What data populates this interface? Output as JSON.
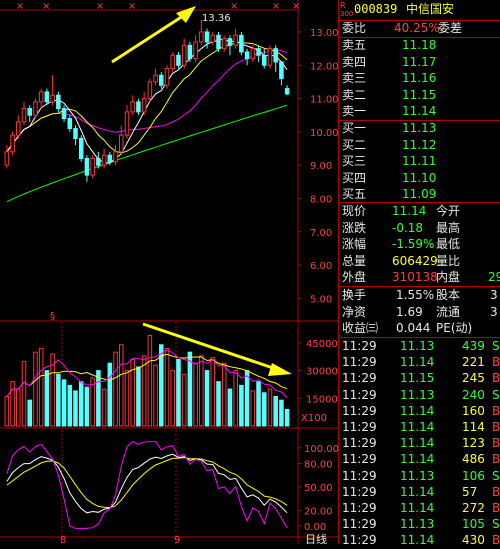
{
  "colors": {
    "bg": "#000000",
    "up": "#ff3232",
    "down": "#54ffff",
    "ma5": "#ffffff",
    "ma10": "#ffff00",
    "ma20": "#ff00ff",
    "ma60": "#00ff00",
    "axis": "#b00000",
    "label_red": "#ff4040",
    "label_green": "#33ff33",
    "label_yellow": "#ffff33",
    "arrow": "#ffff00"
  },
  "header": {
    "code": "000839",
    "name": "中信国安",
    "badge_top": "R",
    "badge_bottom": "300"
  },
  "weibi": {
    "label": "委比",
    "value": "40.25%",
    "label2": "委差"
  },
  "asks": [
    {
      "label": "卖五",
      "price": "11.18"
    },
    {
      "label": "卖四",
      "price": "11.17"
    },
    {
      "label": "卖三",
      "price": "11.16"
    },
    {
      "label": "卖二",
      "price": "11.15"
    },
    {
      "label": "卖一",
      "price": "11.14"
    }
  ],
  "bids": [
    {
      "label": "买一",
      "price": "11.13"
    },
    {
      "label": "买二",
      "price": "11.12"
    },
    {
      "label": "买三",
      "price": "11.11"
    },
    {
      "label": "买四",
      "price": "11.10"
    },
    {
      "label": "买五",
      "price": "11.09"
    }
  ],
  "quote": [
    {
      "label": "现价",
      "value": "11.14",
      "label2": "今开"
    },
    {
      "label": "涨跌",
      "value": "-0.18",
      "label2": "最高"
    },
    {
      "label": "涨幅",
      "value": "-1.59%",
      "label2": "最低"
    },
    {
      "label": "总量",
      "value": "606429",
      "label2": "量比"
    },
    {
      "label": "外盘",
      "value": "310138",
      "label2": "内盘",
      "tail": "29"
    }
  ],
  "stats": [
    {
      "label": "换手",
      "value": "1.55%",
      "label2": "股本",
      "tail": "3"
    },
    {
      "label": "净资",
      "value": "1.69",
      "label2": "流通",
      "tail": "3"
    },
    {
      "label": "收益㈢",
      "value": "0.044",
      "label2": "PE(动)",
      "tail": ""
    }
  ],
  "ticks": [
    {
      "time": "11:29",
      "price": "11.13",
      "vol": "439",
      "flag": "S"
    },
    {
      "time": "11:29",
      "price": "11.14",
      "vol": "221",
      "flag": "B"
    },
    {
      "time": "11:29",
      "price": "11.15",
      "vol": "245",
      "flag": "B"
    },
    {
      "time": "11:29",
      "price": "11.13",
      "vol": "240",
      "flag": "S"
    },
    {
      "time": "11:29",
      "price": "11.14",
      "vol": "160",
      "flag": "B"
    },
    {
      "time": "11:29",
      "price": "11.14",
      "vol": "114",
      "flag": "B"
    },
    {
      "time": "11:29",
      "price": "11.14",
      "vol": "123",
      "flag": "B"
    },
    {
      "time": "11:29",
      "price": "11.14",
      "vol": "486",
      "flag": "B"
    },
    {
      "time": "11:29",
      "price": "11.13",
      "vol": "106",
      "flag": "S"
    },
    {
      "time": "11:29",
      "price": "11.14",
      "vol": "57",
      "flag": "B"
    },
    {
      "time": "11:29",
      "price": "11.14",
      "vol": "272",
      "flag": "B"
    },
    {
      "time": "11:29",
      "price": "11.13",
      "vol": "105",
      "flag": "S"
    },
    {
      "time": "11:29",
      "price": "11.14",
      "vol": "430",
      "flag": "B"
    }
  ],
  "price_chart": {
    "y_ticks": [
      "13.00",
      "12.00",
      "11.00",
      "10.00",
      "9.00",
      "8.00",
      "7.00",
      "6.00",
      "5.00"
    ],
    "high_label": "13.36",
    "top_markers": [
      "×",
      "×",
      "×",
      "×",
      "×",
      "×",
      "×"
    ],
    "month_marker": "§",
    "candles": [
      {
        "o": 9.0,
        "c": 9.4,
        "h": 9.6,
        "l": 8.9
      },
      {
        "o": 9.4,
        "c": 9.9,
        "h": 10.0,
        "l": 9.3
      },
      {
        "o": 9.9,
        "c": 10.3,
        "h": 10.5,
        "l": 9.8
      },
      {
        "o": 10.3,
        "c": 10.7,
        "h": 10.9,
        "l": 10.2
      },
      {
        "o": 10.7,
        "c": 10.5,
        "h": 10.8,
        "l": 10.3
      },
      {
        "o": 10.5,
        "c": 10.9,
        "h": 11.0,
        "l": 10.4
      },
      {
        "o": 10.9,
        "c": 11.2,
        "h": 11.3,
        "l": 10.7
      },
      {
        "o": 11.2,
        "c": 10.9,
        "h": 11.3,
        "l": 10.8
      },
      {
        "o": 10.9,
        "c": 11.1,
        "h": 11.7,
        "l": 10.8
      },
      {
        "o": 11.1,
        "c": 10.7,
        "h": 11.2,
        "l": 10.6
      },
      {
        "o": 10.7,
        "c": 10.4,
        "h": 10.8,
        "l": 10.3
      },
      {
        "o": 10.4,
        "c": 10.1,
        "h": 10.5,
        "l": 10.0
      },
      {
        "o": 10.1,
        "c": 9.8,
        "h": 10.2,
        "l": 9.6
      },
      {
        "o": 9.8,
        "c": 9.2,
        "h": 9.9,
        "l": 9.1
      },
      {
        "o": 9.2,
        "c": 8.7,
        "h": 9.3,
        "l": 8.5
      },
      {
        "o": 8.7,
        "c": 9.2,
        "h": 9.3,
        "l": 8.6
      },
      {
        "o": 9.2,
        "c": 9.0,
        "h": 9.4,
        "l": 8.9
      },
      {
        "o": 9.0,
        "c": 9.3,
        "h": 9.5,
        "l": 8.9
      },
      {
        "o": 9.3,
        "c": 9.1,
        "h": 9.4,
        "l": 9.0
      },
      {
        "o": 9.1,
        "c": 9.4,
        "h": 9.6,
        "l": 9.0
      },
      {
        "o": 9.4,
        "c": 9.9,
        "h": 10.2,
        "l": 9.3
      },
      {
        "o": 9.9,
        "c": 10.6,
        "h": 10.8,
        "l": 9.8
      },
      {
        "o": 10.6,
        "c": 10.9,
        "h": 11.1,
        "l": 10.5
      },
      {
        "o": 10.9,
        "c": 10.6,
        "h": 11.0,
        "l": 10.5
      },
      {
        "o": 10.6,
        "c": 11.0,
        "h": 11.2,
        "l": 10.5
      },
      {
        "o": 11.0,
        "c": 11.5,
        "h": 11.6,
        "l": 10.9
      },
      {
        "o": 11.5,
        "c": 11.7,
        "h": 11.9,
        "l": 11.4
      },
      {
        "o": 11.7,
        "c": 11.4,
        "h": 11.8,
        "l": 11.3
      },
      {
        "o": 11.4,
        "c": 11.9,
        "h": 12.0,
        "l": 11.3
      },
      {
        "o": 11.9,
        "c": 12.3,
        "h": 12.4,
        "l": 11.8
      },
      {
        "o": 12.3,
        "c": 12.0,
        "h": 12.4,
        "l": 11.9
      },
      {
        "o": 12.0,
        "c": 12.6,
        "h": 12.8,
        "l": 11.9
      },
      {
        "o": 12.6,
        "c": 12.2,
        "h": 12.7,
        "l": 12.1
      },
      {
        "o": 12.2,
        "c": 12.7,
        "h": 12.9,
        "l": 12.1
      },
      {
        "o": 12.7,
        "c": 13.0,
        "h": 13.36,
        "l": 12.6
      },
      {
        "o": 13.0,
        "c": 12.7,
        "h": 13.1,
        "l": 12.5
      },
      {
        "o": 12.7,
        "c": 12.9,
        "h": 13.0,
        "l": 12.6
      },
      {
        "o": 12.9,
        "c": 12.5,
        "h": 13.0,
        "l": 12.4
      },
      {
        "o": 12.5,
        "c": 12.8,
        "h": 12.9,
        "l": 12.4
      },
      {
        "o": 12.8,
        "c": 12.6,
        "h": 12.9,
        "l": 12.3
      },
      {
        "o": 12.6,
        "c": 12.9,
        "h": 13.1,
        "l": 12.5
      },
      {
        "o": 12.9,
        "c": 12.4,
        "h": 13.0,
        "l": 12.3
      },
      {
        "o": 12.4,
        "c": 12.2,
        "h": 12.5,
        "l": 12.0
      },
      {
        "o": 12.2,
        "c": 12.5,
        "h": 12.6,
        "l": 12.1
      },
      {
        "o": 12.5,
        "c": 12.3,
        "h": 12.6,
        "l": 12.1
      },
      {
        "o": 12.3,
        "c": 12.0,
        "h": 12.5,
        "l": 11.9
      },
      {
        "o": 12.0,
        "c": 12.5,
        "h": 12.6,
        "l": 11.9
      },
      {
        "o": 12.5,
        "c": 12.1,
        "h": 12.6,
        "l": 11.8
      },
      {
        "o": 12.1,
        "c": 11.6,
        "h": 12.0,
        "l": 11.4
      },
      {
        "o": 11.3,
        "c": 11.14,
        "h": 11.4,
        "l": 11.1
      }
    ],
    "ma60_start": 7.9,
    "ma60_end": 10.8,
    "ylim": [
      4.8,
      13.6
    ]
  },
  "volume_chart": {
    "y_ticks": [
      "45000",
      "30000",
      "15000"
    ],
    "unit": "X100",
    "ylim": [
      0,
      52000
    ],
    "values": [
      16000,
      24000,
      20000,
      35000,
      14000,
      40000,
      42000,
      30000,
      39000,
      28000,
      25000,
      22000,
      19000,
      24000,
      21000,
      26000,
      30000,
      20000,
      34000,
      40000,
      44000,
      30000,
      36000,
      32000,
      38000,
      49000,
      33000,
      44000,
      42000,
      30000,
      36000,
      28000,
      40000,
      34000,
      38000,
      30000,
      37000,
      24000,
      34000,
      20000,
      30000,
      22000,
      30000,
      19000,
      24000,
      18000,
      20000,
      16000,
      14000,
      9000
    ]
  },
  "kdj_chart": {
    "y_ticks": [
      "100.00",
      "80.00",
      "50.00",
      "20.00",
      "0.00"
    ],
    "ylim": [
      -5,
      110
    ]
  },
  "bottom": {
    "label": "日线",
    "tick1": "8",
    "tick2": "9"
  }
}
